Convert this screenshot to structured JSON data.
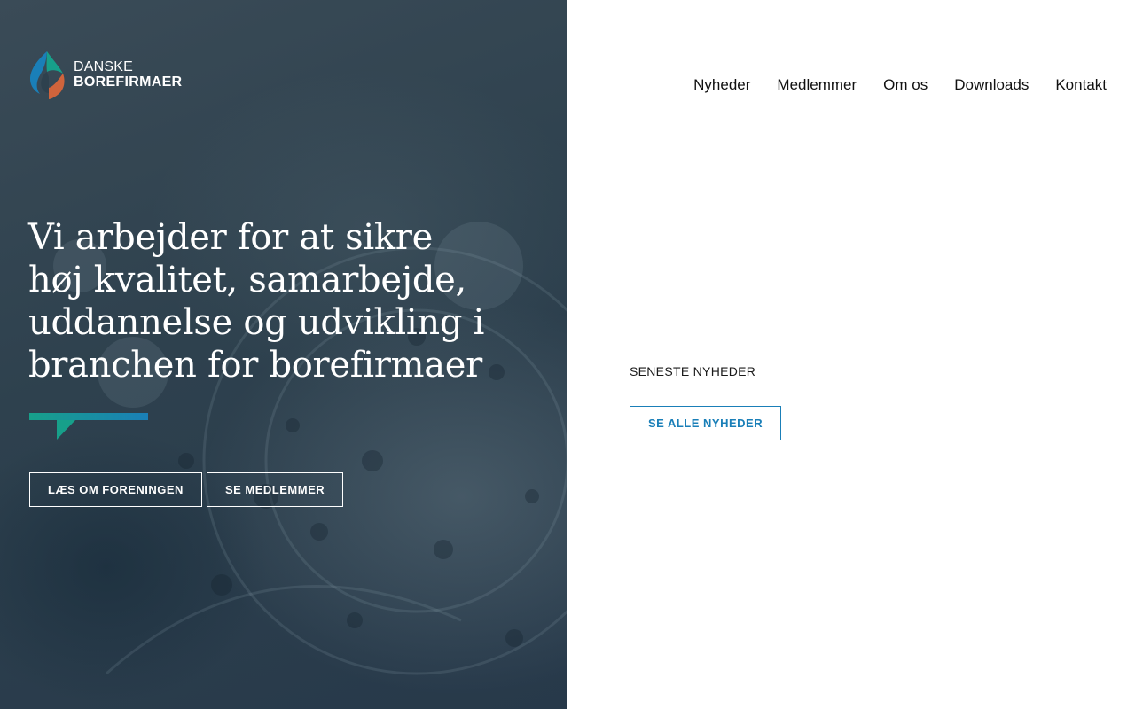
{
  "brand": {
    "logo_line1": "DANSKE",
    "logo_line2": "BOREFIRMAER",
    "colors": {
      "teal": "#17a08a",
      "blue": "#1a7fb8",
      "orange": "#d0643c",
      "hero_bg": "#2e414e"
    }
  },
  "nav": {
    "items": [
      {
        "label": "Nyheder"
      },
      {
        "label": "Medlemmer"
      },
      {
        "label": "Om os"
      },
      {
        "label": "Downloads"
      },
      {
        "label": "Kontakt"
      }
    ]
  },
  "hero": {
    "headline": "Vi arbejder for at sikre høj kvalitet, samarbejde, uddannelse og udvikling i branchen for borefirmaer",
    "buttons": [
      {
        "label": "LÆS OM FORENINGEN"
      },
      {
        "label": "SE MEDLEMMER"
      }
    ]
  },
  "news": {
    "section_label": "SENESTE NYHEDER",
    "see_all_label": "SE ALLE NYHEDER"
  }
}
